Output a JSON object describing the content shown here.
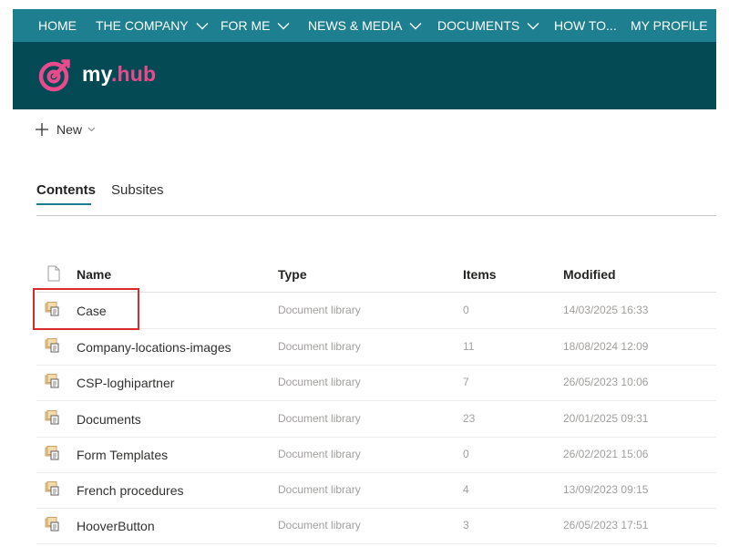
{
  "nav": {
    "items": [
      {
        "label": "HOME",
        "has_dropdown": false
      },
      {
        "label": "THE COMPANY",
        "has_dropdown": true
      },
      {
        "label": "FOR ME",
        "has_dropdown": true
      },
      {
        "label": "NEWS & MEDIA",
        "has_dropdown": true
      },
      {
        "label": "DOCUMENTS",
        "has_dropdown": true
      },
      {
        "label": "HOW TO...",
        "has_dropdown": false
      },
      {
        "label": "MY PROFILE",
        "has_dropdown": false
      }
    ]
  },
  "brand": {
    "part1": "my",
    "dot": ".",
    "part2": "hub"
  },
  "command": {
    "new_label": "New"
  },
  "tabs": [
    {
      "label": "Contents",
      "active": true
    },
    {
      "label": "Subsites",
      "active": false
    }
  ],
  "table": {
    "headers": {
      "name": "Name",
      "type": "Type",
      "items": "Items",
      "modified": "Modified"
    },
    "rows": [
      {
        "name": "Case",
        "type": "Document library",
        "items": "0",
        "modified": "14/03/2025 16:33",
        "highlighted": true
      },
      {
        "name": "Company-locations-images",
        "type": "Document library",
        "items": "11",
        "modified": "18/08/2024 12:09"
      },
      {
        "name": "CSP-loghipartner",
        "type": "Document library",
        "items": "7",
        "modified": "26/05/2023 10:06"
      },
      {
        "name": "Documents",
        "type": "Document library",
        "items": "23",
        "modified": "20/01/2025 09:31"
      },
      {
        "name": "Form Templates",
        "type": "Document library",
        "items": "0",
        "modified": "26/02/2021 15:06"
      },
      {
        "name": "French procedures",
        "type": "Document library",
        "items": "4",
        "modified": "13/09/2023 09:15"
      },
      {
        "name": "HooverButton",
        "type": "Document library",
        "items": "3",
        "modified": "26/05/2023 17:51"
      }
    ]
  },
  "colors": {
    "nav_bg": "#1d7f8f",
    "header_bg": "#044a54",
    "brand_accent": "#e84a8c",
    "highlight_border": "#d92b2b",
    "library_icon": "#c8a46a"
  },
  "icons": {
    "nav_dropdown": "chevron-down-icon",
    "logo": "target-logo-icon",
    "new": "plus-icon",
    "header_file": "file-icon",
    "library": "document-library-icon"
  }
}
